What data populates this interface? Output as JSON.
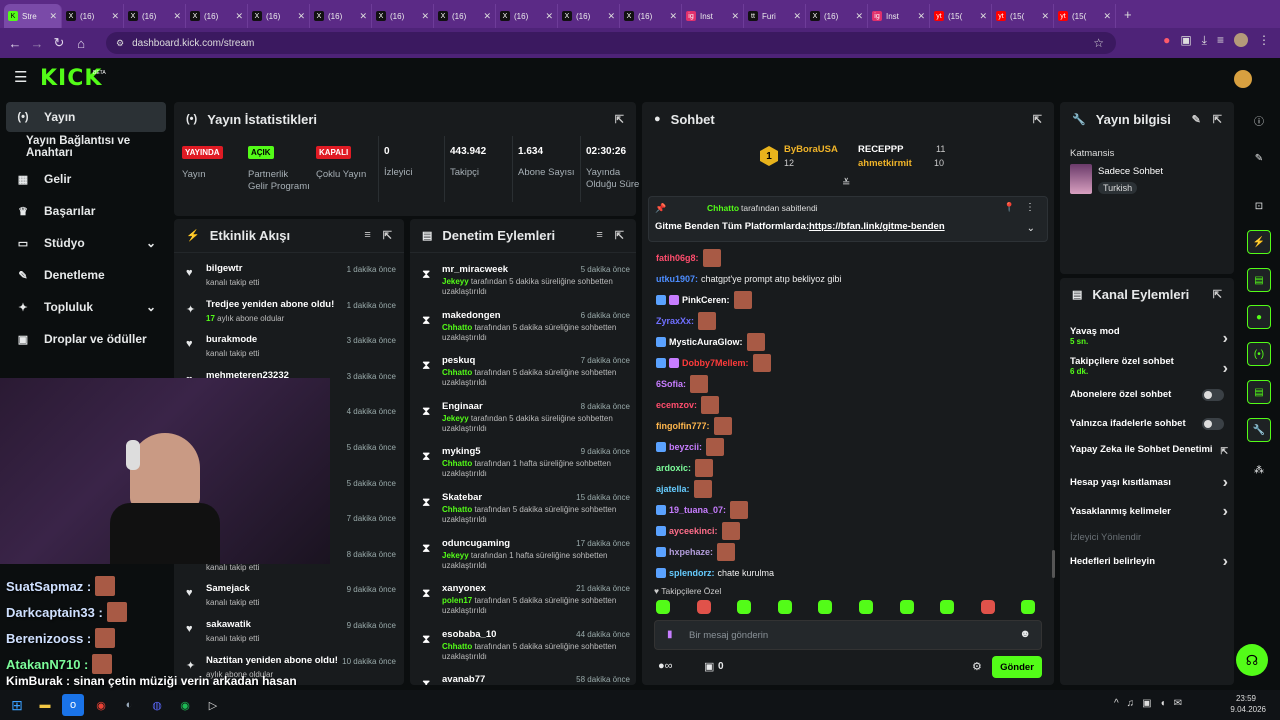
{
  "browser": {
    "tabs": [
      {
        "icon": "K",
        "label": "Stre",
        "active": true,
        "color": "#53fc18"
      },
      {
        "icon": "X",
        "label": "(16)"
      },
      {
        "icon": "X",
        "label": "(16)"
      },
      {
        "icon": "X",
        "label": "(16)"
      },
      {
        "icon": "X",
        "label": "(16)"
      },
      {
        "icon": "X",
        "label": "(16)"
      },
      {
        "icon": "X",
        "label": "(16)"
      },
      {
        "icon": "X",
        "label": "(16)"
      },
      {
        "icon": "X",
        "label": "(16)"
      },
      {
        "icon": "X",
        "label": "(16)"
      },
      {
        "icon": "X",
        "label": "(16)"
      },
      {
        "icon": "ig",
        "label": "Inst"
      },
      {
        "icon": "tt",
        "label": "Furi"
      },
      {
        "icon": "X",
        "label": "(16)"
      },
      {
        "icon": "ig",
        "label": "Inst"
      },
      {
        "icon": "yt",
        "label": "(15("
      },
      {
        "icon": "yt",
        "label": "(15("
      },
      {
        "icon": "yt",
        "label": "(15("
      }
    ],
    "url": "dashboard.kick.com/stream"
  },
  "brand": {
    "logo": "KICK",
    "beta": "BETA"
  },
  "sidebar": {
    "items": [
      {
        "label": "Yayın",
        "icon": "(•)",
        "active": true
      },
      {
        "label": "Yayın Bağlantısı ve Anahtarı"
      },
      {
        "label": "Gelir",
        "icon": "▦"
      },
      {
        "label": "Başarılar",
        "icon": "♛"
      },
      {
        "label": "Stüdyo",
        "icon": "▭",
        "chev": "⌄"
      },
      {
        "label": "Denetleme",
        "icon": "✎"
      },
      {
        "label": "Topluluk",
        "icon": "✦",
        "chev": "⌄"
      },
      {
        "label": "Droplar ve ödüller",
        "icon": "▣"
      }
    ]
  },
  "stats": {
    "title": "Yayın İstatistikleri",
    "items": [
      {
        "badge": "YAYINDA",
        "label": "Yayın"
      },
      {
        "badge": "AÇIK",
        "label": "Partnerlik Gelir Programı"
      },
      {
        "badge": "KAPALI",
        "label": "Çoklu Yayın"
      },
      {
        "value": "0",
        "label": "İzleyici"
      },
      {
        "value": "443.942",
        "label": "Takipçi"
      },
      {
        "value": "1.634",
        "label": "Abone Sayısı"
      },
      {
        "value": "02:30:26",
        "label": "Yayında Olduğu Süre"
      }
    ]
  },
  "feed": {
    "title": "Etkinlik Akışı",
    "rows": [
      {
        "name": "bilgewtr",
        "sub": "kanalı takip etti",
        "time": "1 dakika önce",
        "icon": "♥"
      },
      {
        "name": "Tredjee yeniden abone oldu!",
        "subb": "17",
        "sub": " aylık abone oldular",
        "time": "1 dakika önce",
        "icon": "✦"
      },
      {
        "name": "burakmode",
        "sub": "kanalı takip etti",
        "time": "3 dakika önce",
        "icon": "♥"
      },
      {
        "name": "mehmeteren23232",
        "sub": "",
        "time": "3 dakika önce",
        "icon": "♥"
      },
      {
        "name": "",
        "sub": "",
        "time": "4 dakika önce",
        "icon": ""
      },
      {
        "name": "",
        "sub": "",
        "time": "5 dakika önce",
        "icon": ""
      },
      {
        "name": "",
        "sub": "",
        "time": "5 dakika önce",
        "icon": ""
      },
      {
        "name": "",
        "sub": "",
        "time": "7 dakika önce",
        "icon": ""
      },
      {
        "name": "",
        "sub": "kanalı takip etti",
        "time": "8 dakika önce",
        "icon": ""
      },
      {
        "name": "Samejack",
        "sub": "kanalı takip etti",
        "time": "9 dakika önce",
        "icon": "♥"
      },
      {
        "name": "sakawatik",
        "sub": "kanalı takip etti",
        "time": "9 dakika önce",
        "icon": "♥"
      },
      {
        "name": "Naztitan yeniden abone oldu!",
        "sub": "aylık abone oldular",
        "time": "10 dakika önce",
        "icon": "✦"
      }
    ]
  },
  "mod": {
    "title": "Denetim Eylemleri",
    "rows": [
      {
        "name": "mr_miracweek",
        "by": "Jekeyy",
        "sub": " tarafından 5 dakika süreliğine sohbetten uzaklaştırıldı",
        "time": "5 dakika önce"
      },
      {
        "name": "makedongen",
        "by": "Chhatto",
        "sub": " tarafından 5 dakika süreliğine sohbetten uzaklaştırıldı",
        "time": "6 dakika önce"
      },
      {
        "name": "peskuq",
        "by": "Chhatto",
        "sub": " tarafından 5 dakika süreliğine sohbetten uzaklaştırıldı",
        "time": "7 dakika önce"
      },
      {
        "name": "Enginaar",
        "by": "Jekeyy",
        "sub": " tarafından 5 dakika süreliğine sohbetten uzaklaştırıldı",
        "time": "8 dakika önce"
      },
      {
        "name": "myking5",
        "by": "Chhatto",
        "sub": " tarafından 1 hafta süreliğine sohbetten uzaklaştırıldı",
        "time": "9 dakika önce"
      },
      {
        "name": "Skatebar",
        "by": "Chhatto",
        "sub": " tarafından 5 dakika süreliğine sohbetten uzaklaştırıldı",
        "time": "15 dakika önce"
      },
      {
        "name": "oduncugaming",
        "by": "Jekeyy",
        "sub": " tarafından 1 hafta süreliğine sohbetten uzaklaştırıldı",
        "time": "17 dakika önce"
      },
      {
        "name": "xanyonex",
        "by": "polen17",
        "sub": " tarafından 5 dakika süreliğine sohbetten uzaklaştırıldı",
        "time": "21 dakika önce"
      },
      {
        "name": "esobaba_10",
        "by": "Chhatto",
        "sub": " tarafından 5 dakika süreliğine sohbetten uzaklaştırıldı",
        "time": "44 dakika önce"
      },
      {
        "name": "avanab77",
        "by": "",
        "sub": "",
        "time": "58 dakika önce"
      }
    ]
  },
  "chat": {
    "title": "Sohbet",
    "top": [
      {
        "rank": "1",
        "name": "ByBoraUSA",
        "count": "12"
      },
      {
        "name": "RECEPPP",
        "count": "11"
      },
      {
        "name": "ahmetkirmit",
        "count": "10"
      }
    ],
    "pinned": {
      "by": "Chhatto",
      "by_suffix": "tarafından sabitlendi",
      "text": "Gitme Benden Tüm Platformlarda: ",
      "link": "https://bfan.link/gitme-benden"
    },
    "messages": [
      {
        "user": "fatih06g8:",
        "color": "#ff4d6d",
        "text": "",
        "emo": true
      },
      {
        "user": "utku1907:",
        "color": "#4d8dff",
        "text": "chatgpt'ye prompt atıp bekliyoz gibi"
      },
      {
        "user": "PinkCeren:",
        "color": "#ffffff",
        "text": "",
        "emo": true,
        "b": 2
      },
      {
        "user": "ZyraxXx:",
        "color": "#6f6fff",
        "text": "",
        "emo": true
      },
      {
        "user": "MysticAuraGlow:",
        "color": "#ffffff",
        "text": "",
        "emo": true,
        "b": 1
      },
      {
        "user": "Dobby7Mellem:",
        "color": "#ff3b3b",
        "text": "",
        "emo": true,
        "b": 2
      },
      {
        "user": "6Sofia:",
        "color": "#c77dff",
        "text": "",
        "emo": true
      },
      {
        "user": "ecemzov:",
        "color": "#ff4d6d",
        "text": "",
        "emo": true
      },
      {
        "user": "fingolfin777:",
        "color": "#ffb74d",
        "text": "",
        "emo": true
      },
      {
        "user": "beyzcii:",
        "color": "#c77dff",
        "text": "",
        "emo": true,
        "b": 1
      },
      {
        "user": "ardoxic:",
        "color": "#7cfc9a",
        "text": "",
        "emo": true
      },
      {
        "user": "ajatella:",
        "color": "#66ccff",
        "text": "",
        "emo": true
      },
      {
        "user": "19_tuana_07:",
        "color": "#c77dff",
        "text": "",
        "emo": true,
        "b": 1
      },
      {
        "user": "ayceekinci:",
        "color": "#ff6e8a",
        "text": "",
        "emo": true,
        "b": 1
      },
      {
        "user": "hxpehaze:",
        "color": "#b39ddb",
        "text": "",
        "emo": true,
        "b": 1
      },
      {
        "user": "splendorz:",
        "color": "#66ccff",
        "text": "chate kurulma",
        "b": 1
      }
    ],
    "mode": "Takipçilere Özel",
    "placeholder": "Bir mesaj gönderin",
    "count": "0",
    "send": "Gönder"
  },
  "info": {
    "title": "Yayın bilgisi",
    "category": "Katmansis",
    "tag1": "Sadece Sohbet",
    "tag2": "Turkish"
  },
  "actions": {
    "title": "Kanal Eylemleri",
    "rows": [
      {
        "label": "Yavaş mod",
        "sub": "5 sn.",
        "kind": "chev"
      },
      {
        "label": "Takipçilere özel sohbet",
        "sub": "6 dk.",
        "kind": "chev"
      },
      {
        "label": "Abonelere özel sohbet",
        "kind": "toggle"
      },
      {
        "label": "Yalnızca ifadelerle sohbet",
        "kind": "toggle"
      },
      {
        "label": "Yapay Zeka ile Sohbet Denetimi",
        "kind": "ext"
      },
      {
        "label": "Hesap yaşı kısıtlaması",
        "kind": "chev"
      },
      {
        "label": "Yasaklanmış kelimeler",
        "kind": "chev"
      },
      {
        "label": "İzleyici Yönlendir",
        "kind": "disabled"
      },
      {
        "label": "Hedefleri belirleyin",
        "kind": "chev"
      }
    ]
  },
  "overlay": {
    "names": [
      "SuatSapmaz :",
      "Darkcaptain33 :",
      "Berenizooss :",
      "AtakanN710 :"
    ],
    "last": "KimBurak : sinan çetin müziği verin arkadan hasan"
  },
  "taskbar": {
    "time": "23:59",
    "date": "9.04.2026"
  }
}
